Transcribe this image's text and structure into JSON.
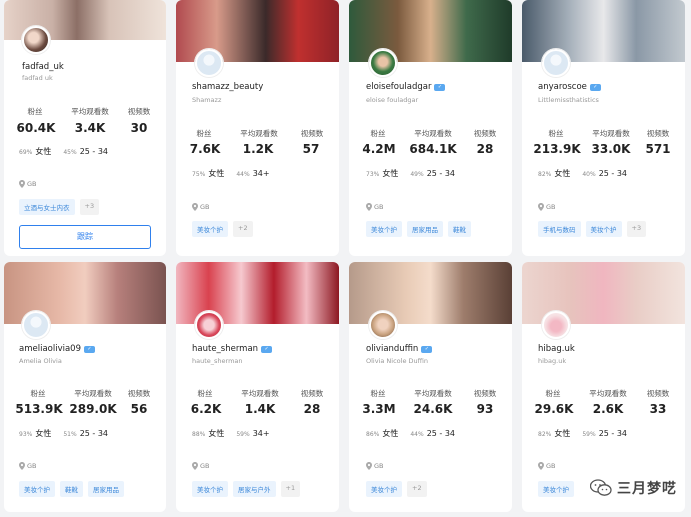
{
  "labels": {
    "followers": "粉丝",
    "avg_views": "平均观看数",
    "videos": "视频数",
    "female": "女性"
  },
  "cards": [
    {
      "name": "fadfad_uk",
      "handle": "fadfad uk",
      "verified": false,
      "followers": "60.4K",
      "avg_views": "3.4K",
      "videos": "30",
      "female_pct": "69%",
      "age_pct": "45%",
      "age": "25 - 34",
      "location": "GB",
      "tags": [
        "立酒与女士内衣"
      ],
      "more": "+3",
      "follow_label": "跟踪"
    },
    {
      "name": "shamazz_beauty",
      "handle": "Shamazz",
      "verified": false,
      "followers": "7.6K",
      "avg_views": "1.2K",
      "videos": "57",
      "female_pct": "75%",
      "age_pct": "44%",
      "age": "34+",
      "location": "GB",
      "tags": [
        "美妆个护"
      ],
      "more": "+2"
    },
    {
      "name": "eloisefouladgar",
      "handle": "eloise fouladgar",
      "verified": true,
      "followers": "4.2M",
      "avg_views": "684.1K",
      "videos": "28",
      "female_pct": "73%",
      "age_pct": "49%",
      "age": "25 - 34",
      "location": "GB",
      "tags": [
        "美妆个护",
        "居家用品",
        "鞋靴"
      ],
      "more": ""
    },
    {
      "name": "anyaroscoe",
      "handle": "Littlemissthatistics",
      "verified": true,
      "followers": "213.9K",
      "avg_views": "33.0K",
      "videos": "571",
      "female_pct": "82%",
      "age_pct": "40%",
      "age": "25 - 34",
      "location": "GB",
      "tags": [
        "手机与数码",
        "美妆个护"
      ],
      "more": "+3"
    },
    {
      "name": "ameliaolivia09",
      "handle": "Amelia Olivia",
      "verified": true,
      "followers": "513.9K",
      "avg_views": "289.0K",
      "videos": "56",
      "female_pct": "93%",
      "age_pct": "51%",
      "age": "25 - 34",
      "location": "GB",
      "tags": [
        "美妆个护",
        "鞋靴",
        "居家用品"
      ],
      "more": ""
    },
    {
      "name": "haute_sherman",
      "handle": "haute_sherman",
      "verified": true,
      "followers": "6.2K",
      "avg_views": "1.4K",
      "videos": "28",
      "female_pct": "88%",
      "age_pct": "59%",
      "age": "34+",
      "location": "GB",
      "tags": [
        "美妆个护",
        "居家与户外"
      ],
      "more": "+1"
    },
    {
      "name": "olivianduffin",
      "handle": "Olivia Nicole Duffin",
      "verified": true,
      "followers": "3.3M",
      "avg_views": "24.6K",
      "videos": "93",
      "female_pct": "86%",
      "age_pct": "44%",
      "age": "25 - 34",
      "location": "GB",
      "tags": [
        "美妆个护"
      ],
      "more": "+2"
    },
    {
      "name": "hibag.uk",
      "handle": "hibag.uk",
      "verified": false,
      "followers": "29.6K",
      "avg_views": "2.6K",
      "videos": "33",
      "female_pct": "82%",
      "age_pct": "59%",
      "age": "25 - 34",
      "location": "GB",
      "tags": [
        "美妆个护"
      ],
      "more": ""
    }
  ],
  "watermark": {
    "text": "三月梦呓"
  }
}
